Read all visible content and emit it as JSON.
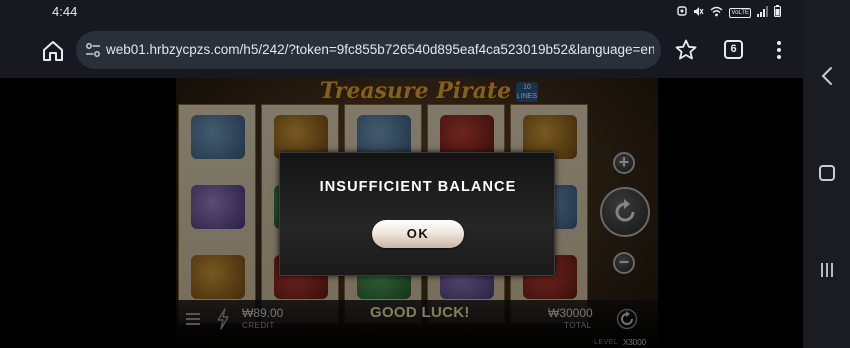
{
  "status_bar": {
    "time": "4:44",
    "icons": [
      "notification-icon",
      "mute-icon",
      "wifi-icon",
      "volte-icon",
      "signal-icon",
      "battery-icon"
    ],
    "volte_label": "VoLTE"
  },
  "browser": {
    "url": "web01.hrbzycpzs.com/h5/242/?token=9fc855b726540d895eaf4ca523019b52&language=en&dollars",
    "tab_count": "6"
  },
  "game": {
    "title": "Treasure Pirate",
    "lines_badge": "10 LINES",
    "credit_value": "₩89.00",
    "credit_label": "CREDIT",
    "message": "GOOD LUCK!",
    "total_value": "₩30000",
    "total_label": "TOTAL",
    "level_label": "LEVEL",
    "level_value": "X3000"
  },
  "modal": {
    "title": "INSUFFICIENT BALANCE",
    "ok_label": "OK"
  },
  "colors": {
    "browser_bg": "#16191f",
    "urlbar_bg": "#2a2f38",
    "logo_gold": "#e8b23a",
    "modal_bg": "#1e1e1e"
  }
}
